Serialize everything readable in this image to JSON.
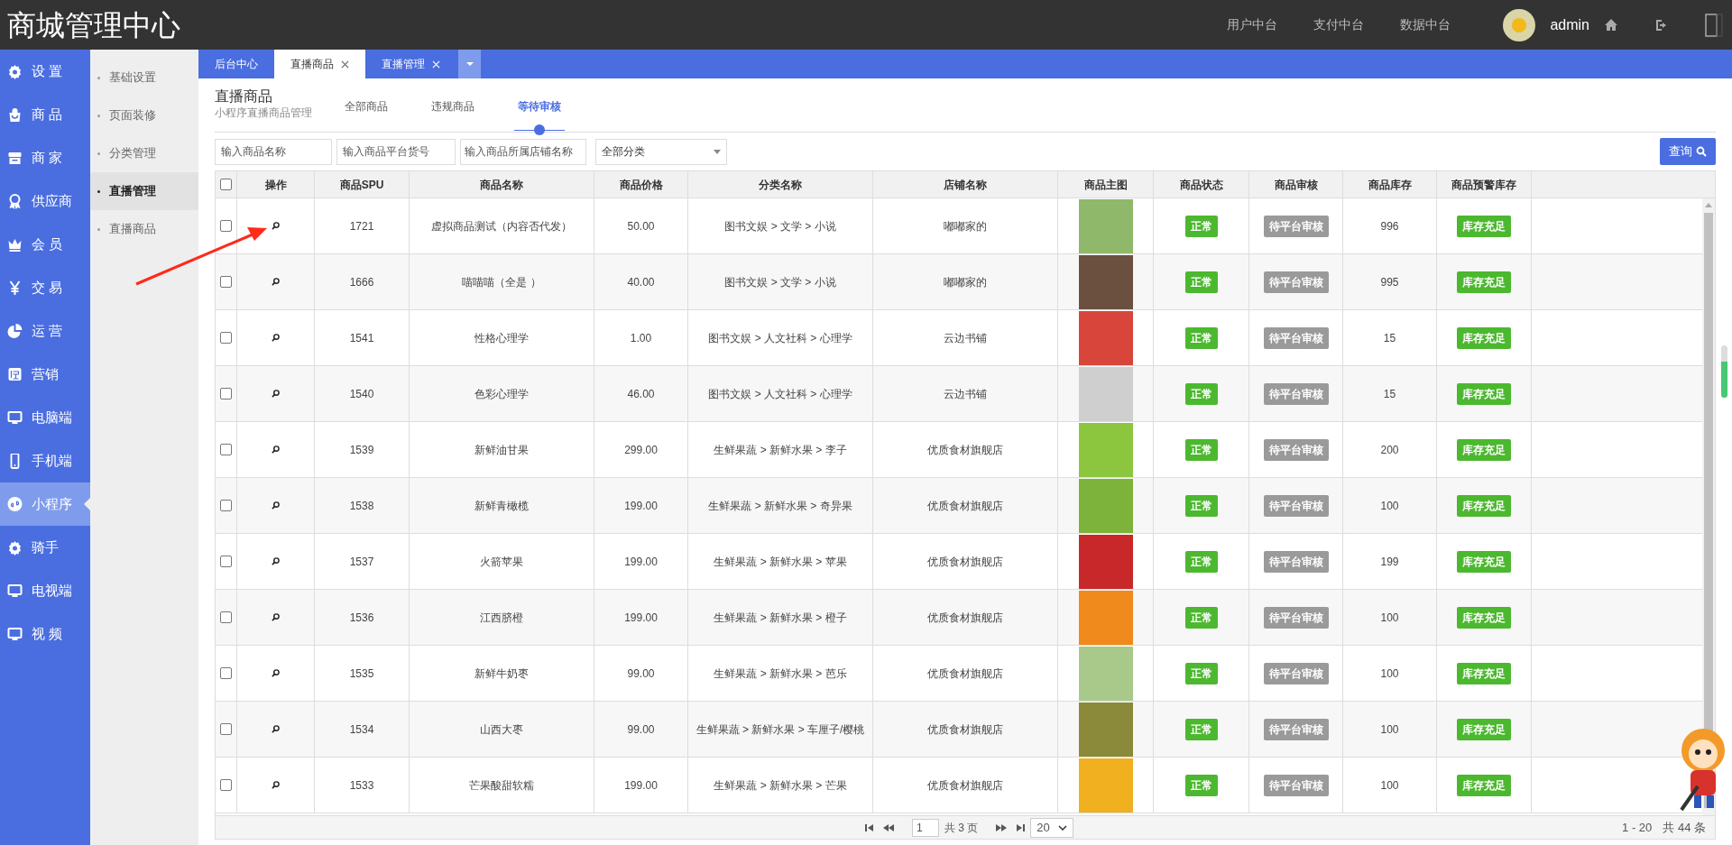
{
  "header": {
    "title": "商城管理中心",
    "nav_links": [
      "用户中台",
      "支付中台",
      "数据中台"
    ],
    "user": "admin"
  },
  "sidebar": {
    "items": [
      {
        "label": "设 置",
        "selected": false
      },
      {
        "label": "商 品",
        "selected": false
      },
      {
        "label": "商 家",
        "selected": false
      },
      {
        "label": "供应商",
        "selected": false
      },
      {
        "label": "会 员",
        "selected": false
      },
      {
        "label": "交 易",
        "selected": false
      },
      {
        "label": "运 营",
        "selected": false
      },
      {
        "label": "营销",
        "selected": false
      },
      {
        "label": "电脑端",
        "selected": false
      },
      {
        "label": "手机端",
        "selected": false
      },
      {
        "label": "小程序",
        "selected": true
      },
      {
        "label": "骑手",
        "selected": false
      },
      {
        "label": "电视端",
        "selected": false
      },
      {
        "label": "视 频",
        "selected": false
      }
    ]
  },
  "subnav": {
    "items": [
      {
        "label": "基础设置",
        "selected": false
      },
      {
        "label": "页面装修",
        "selected": false
      },
      {
        "label": "分类管理",
        "selected": false
      },
      {
        "label": "直播管理",
        "selected": true
      },
      {
        "label": "直播商品",
        "selected": false
      }
    ]
  },
  "tabs": [
    {
      "label": "后台中心",
      "selected": false,
      "closable": false
    },
    {
      "label": "直播商品",
      "selected": true,
      "closable": true
    },
    {
      "label": "直播管理",
      "selected": false,
      "closable": true
    }
  ],
  "page": {
    "title": "直播商品",
    "subtitle": "小程序直播商品管理",
    "subtabs": [
      {
        "label": "全部商品",
        "selected": false
      },
      {
        "label": "违规商品",
        "selected": false
      },
      {
        "label": "等待审核",
        "selected": true
      }
    ]
  },
  "filters": {
    "name": {
      "placeholder": "输入商品名称"
    },
    "code": {
      "placeholder": "输入商品平台货号"
    },
    "store": {
      "placeholder": "输入商品所属店铺名称"
    },
    "category": {
      "value": "全部分类"
    },
    "search_button": "查询"
  },
  "table": {
    "header_checked": false,
    "columns": [
      "操作",
      "商品SPU",
      "商品名称",
      "商品价格",
      "分类名称",
      "店铺名称",
      "商品主图",
      "商品状态",
      "商品审核",
      "商品库存",
      "商品预警库存"
    ],
    "rows": [
      {
        "checked": false,
        "spu": "1721",
        "name": "虚拟商品测试（内容否代发）",
        "price": "50.00",
        "category": "图书文娱 > 文学 > 小说",
        "store": "嘟嘟家的",
        "color": "#8fb86a",
        "status": "正常",
        "audit": "待平台审核",
        "stock": "996",
        "warning": "库存充足"
      },
      {
        "checked": false,
        "spu": "1666",
        "name": "喵喵喵（全是 ）",
        "price": "40.00",
        "category": "图书文娱 > 文学 > 小说",
        "store": "嘟嘟家的",
        "color": "#6b5040",
        "status": "正常",
        "audit": "待平台审核",
        "stock": "995",
        "warning": "库存充足"
      },
      {
        "checked": false,
        "spu": "1541",
        "name": "性格心理学",
        "price": "1.00",
        "category": "图书文娱 > 人文社科 > 心理学",
        "store": "云边书铺",
        "color": "#d8453a",
        "status": "正常",
        "audit": "待平台审核",
        "stock": "15",
        "warning": "库存充足"
      },
      {
        "checked": false,
        "spu": "1540",
        "name": "色彩心理学",
        "price": "46.00",
        "category": "图书文娱 > 人文社科 > 心理学",
        "store": "云边书铺",
        "color": "#cfcfcf",
        "status": "正常",
        "audit": "待平台审核",
        "stock": "15",
        "warning": "库存充足"
      },
      {
        "checked": false,
        "spu": "1539",
        "name": "新鲜油甘果",
        "price": "299.00",
        "category": "生鲜果蔬 > 新鲜水果 > 李子",
        "store": "优质食材旗舰店",
        "color": "#8cc63f",
        "status": "正常",
        "audit": "待平台审核",
        "stock": "200",
        "warning": "库存充足"
      },
      {
        "checked": false,
        "spu": "1538",
        "name": "新鲜青橄榄",
        "price": "199.00",
        "category": "生鲜果蔬 > 新鲜水果 > 奇异果",
        "store": "优质食材旗舰店",
        "color": "#7db33a",
        "status": "正常",
        "audit": "待平台审核",
        "stock": "100",
        "warning": "库存充足"
      },
      {
        "checked": false,
        "spu": "1537",
        "name": "火箭苹果",
        "price": "199.00",
        "category": "生鲜果蔬 > 新鲜水果 > 苹果",
        "store": "优质食材旗舰店",
        "color": "#c8282a",
        "status": "正常",
        "audit": "待平台审核",
        "stock": "199",
        "warning": "库存充足"
      },
      {
        "checked": false,
        "spu": "1536",
        "name": "江西脐橙",
        "price": "199.00",
        "category": "生鲜果蔬 > 新鲜水果 > 橙子",
        "store": "优质食材旗舰店",
        "color": "#f08a1c",
        "status": "正常",
        "audit": "待平台审核",
        "stock": "100",
        "warning": "库存充足"
      },
      {
        "checked": false,
        "spu": "1535",
        "name": "新鲜牛奶枣",
        "price": "99.00",
        "category": "生鲜果蔬 > 新鲜水果 > 芭乐",
        "store": "优质食材旗舰店",
        "color": "#a9c98a",
        "status": "正常",
        "audit": "待平台审核",
        "stock": "100",
        "warning": "库存充足"
      },
      {
        "checked": false,
        "spu": "1534",
        "name": "山西大枣",
        "price": "99.00",
        "category": "生鲜果蔬 > 新鲜水果 > 车厘子/樱桃",
        "store": "优质食材旗舰店",
        "color": "#8a8a3a",
        "status": "正常",
        "audit": "待平台审核",
        "stock": "100",
        "warning": "库存充足"
      },
      {
        "checked": false,
        "spu": "1533",
        "name": "芒果酸甜软糯",
        "price": "199.00",
        "category": "生鲜果蔬 > 新鲜水果 > 芒果",
        "store": "优质食材旗舰店",
        "color": "#f0b020",
        "status": "正常",
        "audit": "待平台审核",
        "stock": "100",
        "warning": "库存充足"
      }
    ]
  },
  "pagination": {
    "page": "1",
    "pages": "共 3 页",
    "per_page": "20",
    "range": "1 - 20",
    "total": "共 44 条"
  }
}
